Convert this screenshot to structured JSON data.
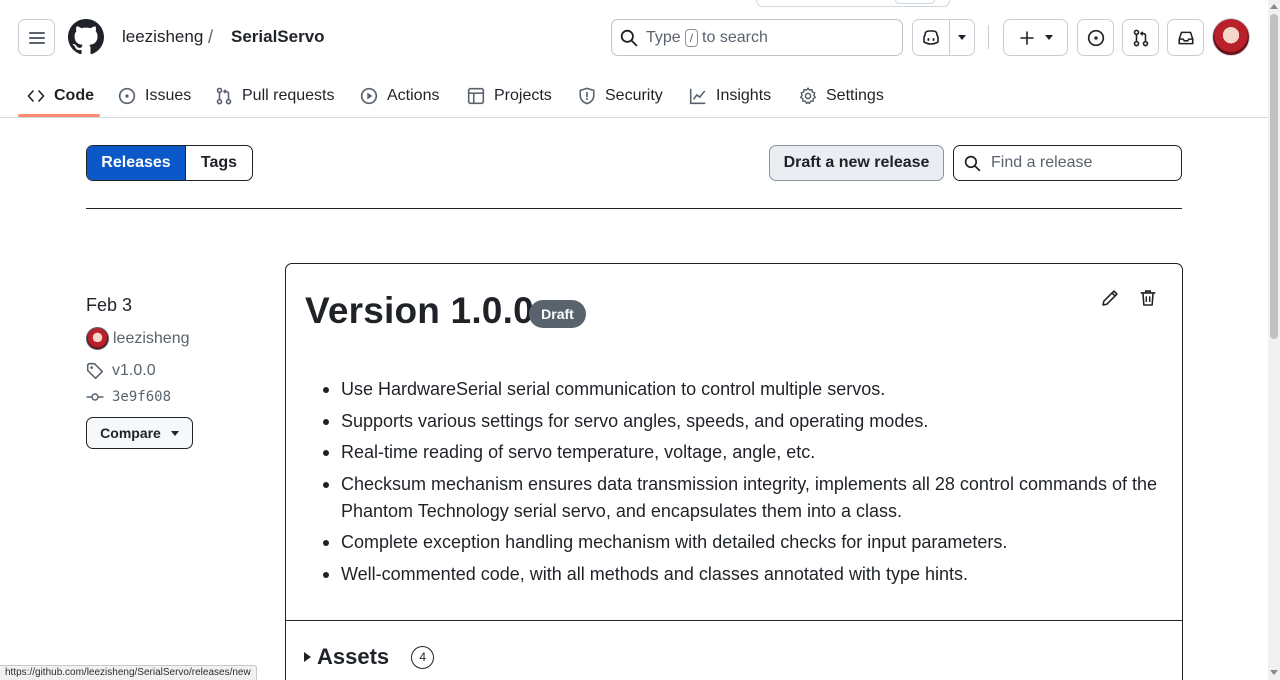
{
  "header": {
    "owner": "leezisheng",
    "separator": "/",
    "repo": "SerialServo",
    "search": {
      "prefix": "Type",
      "kbd": "/",
      "suffix": "to search"
    }
  },
  "tabs": [
    {
      "label": "Code",
      "icon": "code-icon",
      "active": true
    },
    {
      "label": "Issues",
      "icon": "issue-opened-icon"
    },
    {
      "label": "Pull requests",
      "icon": "git-pull-request-icon"
    },
    {
      "label": "Actions",
      "icon": "play-icon"
    },
    {
      "label": "Projects",
      "icon": "table-icon"
    },
    {
      "label": "Security",
      "icon": "shield-icon"
    },
    {
      "label": "Insights",
      "icon": "graph-icon"
    },
    {
      "label": "Settings",
      "icon": "gear-icon"
    }
  ],
  "subnav": {
    "releases_label": "Releases",
    "tags_label": "Tags",
    "draft_button": "Draft a new release",
    "find_placeholder": "Find a release"
  },
  "release": {
    "date": "Feb 3",
    "author": "leezisheng",
    "tag": "v1.0.0",
    "commit": "3e9f608",
    "compare_label": "Compare",
    "title": "Version 1.0.0",
    "badge": "Draft",
    "notes": [
      "Use HardwareSerial serial communication to control multiple servos.",
      "Supports various settings for servo angles, speeds, and operating modes.",
      "Real-time reading of servo temperature, voltage, angle, etc.",
      "Checksum mechanism ensures data transmission integrity, implements all 28 control commands of the Phantom Technology serial servo, and encapsulates them into a class.",
      "Complete exception handling mechanism with detailed checks for input parameters.",
      "Well-commented code, with all methods and classes annotated with type hints."
    ],
    "assets_label": "Assets",
    "assets_count": "4"
  },
  "status_bar_url": "https://github.com/leezisheng/SerialServo/releases/new",
  "colors": {
    "accent_blue": "#0b59c9",
    "tab_underline": "#fd8c73",
    "badge_gray": "#59636e",
    "text": "#1f2328"
  }
}
